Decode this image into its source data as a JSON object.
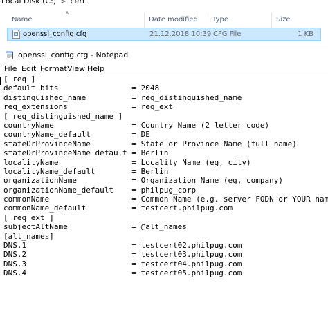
{
  "explorer": {
    "breadcrumb": [
      "Local Disk (C:)",
      "cert"
    ],
    "breadcrumb_sep": ">",
    "columns": [
      "Name",
      "Date modified",
      "Type",
      "Size"
    ],
    "file": {
      "name": "openssl_config.cfg",
      "date": "21.12.2018 10:39",
      "type": "CFG File",
      "size": "1 KB"
    }
  },
  "notepad": {
    "title": "openssl_config.cfg - Notepad",
    "menu": [
      "File",
      "Edit",
      "Format",
      "View",
      "Help"
    ],
    "lines": [
      "[ req ]",
      "default_bits                = 2048",
      "distinguished_name          = req_distinguished_name",
      "req_extensions              = req_ext",
      "[ req_distinguished_name ]",
      "countryName                 = Country Name (2 letter code)",
      "countryName_default         = DE",
      "stateOrProvinceName         = State or Province Name (full name)",
      "stateOrProvinceName_default = Berlin",
      "localityName                = Locality Name (eg, city)",
      "localityName_default        = Berlin",
      "organizationName            = Organization Name (eg, company)",
      "organizationName_default    = philpug_corp",
      "commonName                  = Common Name (e.g. server FQDN or YOUR name)",
      "commonName_default          = testcert.philpug.com",
      "[ req_ext ]",
      "subjectAltName              = @alt_names",
      "[alt_names]",
      "DNS.1                       = testcert02.philpug.com",
      "DNS.2                       = testcert03.philpug.com",
      "DNS.3                       = testcert04.philpug.com",
      "DNS.4                       = testcert05.philpug.com"
    ]
  },
  "colors": {
    "selection": "#cce8ff",
    "selection_border": "#99d1ff",
    "header_text": "#4c607a"
  },
  "icons": {
    "file": "config-file-icon",
    "notepad": "notepad-icon",
    "collapse": "chevron-up-icon"
  }
}
